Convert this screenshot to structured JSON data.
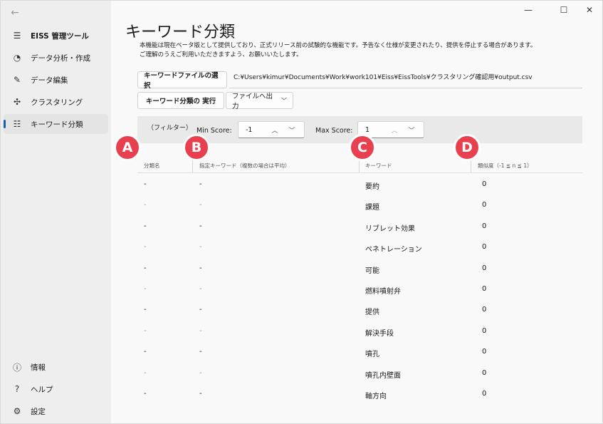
{
  "window": {
    "controls": {
      "minimize": "—",
      "maximize": "☐",
      "close": "✕"
    }
  },
  "sidebar": {
    "app_title": "EISS 管理ツール",
    "items": [
      {
        "label": "データ分析・作成",
        "icon": "pie-chart-icon"
      },
      {
        "label": "データ編集",
        "icon": "pencil-icon"
      },
      {
        "label": "クラスタリング",
        "icon": "cluster-icon"
      },
      {
        "label": "キーワード分類",
        "icon": "list-icon"
      }
    ],
    "footer": [
      {
        "label": "情報",
        "icon": "info-icon"
      },
      {
        "label": "ヘルプ",
        "icon": "help-icon"
      },
      {
        "label": "設定",
        "icon": "gear-icon"
      }
    ]
  },
  "main": {
    "title": "キーワード分類",
    "description_line1": "本機能は現在ベータ版として提供しており、正式リリース前の試験的な機能です。予告なく仕様が変更されたり、提供を停止する場合があります。",
    "description_line2": "ご理解のうえご利用いただきますよう、お願いいたします。",
    "select_file_button": "キーワードファイルの選択",
    "file_path": "C:¥Users¥kimur¥Documents¥Work¥work101¥Eiss¥EissTools¥クラスタリング確認用¥output.csv",
    "run_button": "キーワード分類の 実行",
    "export_button": "ファイルへ出力",
    "filter": {
      "label": "（フィルター）",
      "min_label": "Min Score:",
      "min_value": "-1",
      "max_label": "Max Score:",
      "max_value": "1"
    },
    "table": {
      "headers": [
        "分類名",
        "指定キーワード（複数の場合は平均）",
        "キーワード",
        "類似度（-1 ≦ n ≦ 1）"
      ],
      "rows": [
        [
          "-",
          "-",
          "要約",
          "0"
        ],
        [
          "-",
          "-",
          "課題",
          "0"
        ],
        [
          "-",
          "-",
          "リブレット効果",
          "0"
        ],
        [
          "-",
          "-",
          "ペネトレーション",
          "0"
        ],
        [
          "-",
          "-",
          "可能",
          "0"
        ],
        [
          "-",
          "-",
          "燃料噴射弁",
          "0"
        ],
        [
          "-",
          "-",
          "提供",
          "0"
        ],
        [
          "-",
          "-",
          "解決手段",
          "0"
        ],
        [
          "-",
          "-",
          "噴孔",
          "0"
        ],
        [
          "-",
          "-",
          "噴孔内壁面",
          "0"
        ],
        [
          "-",
          "-",
          "軸方向",
          "0"
        ]
      ]
    },
    "markers": [
      "A",
      "B",
      "C",
      "D"
    ]
  }
}
